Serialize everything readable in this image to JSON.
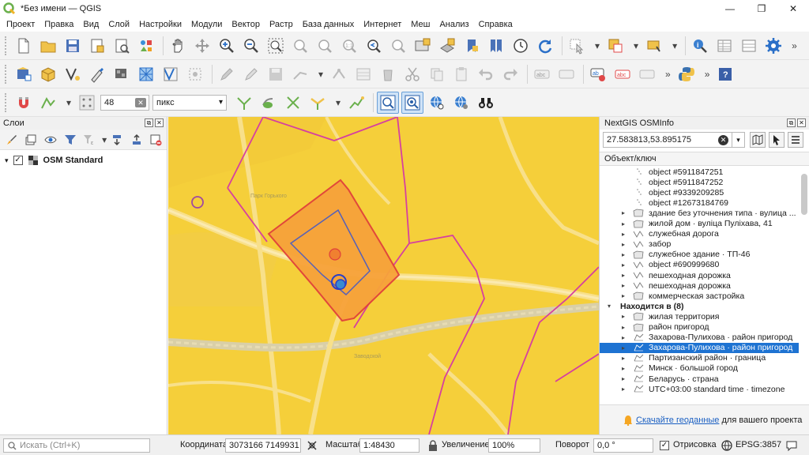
{
  "window": {
    "title": "*Без имени — QGIS"
  },
  "menu": [
    "Проект",
    "Правка",
    "Вид",
    "Слой",
    "Настройки",
    "Модули",
    "Вектор",
    "Растр",
    "База данных",
    "Интернет",
    "Меш",
    "Анализ",
    "Справка"
  ],
  "toolbar3": {
    "snap_tolerance": "48",
    "units": "пикс"
  },
  "layers_panel": {
    "title": "Слои",
    "layers": [
      {
        "name": "OSM Standard",
        "checked": true
      }
    ]
  },
  "osm_panel": {
    "title": "NextGIS OSMInfo",
    "coordinates": "27.583813,53.895175",
    "column_header": "Объект/ключ",
    "rows": [
      {
        "text": "object #5911847251",
        "level": 3,
        "type": "node",
        "expand": false
      },
      {
        "text": "object #5911847252",
        "level": 3,
        "type": "node",
        "expand": false
      },
      {
        "text": "object #9339209285",
        "level": 3,
        "type": "node",
        "expand": false
      },
      {
        "text": "object #12673184769",
        "level": 3,
        "type": "node",
        "expand": false
      },
      {
        "text": "здание без уточнения типа · вулица ...",
        "level": 1,
        "type": "area",
        "expand": true
      },
      {
        "text": "жилой дом · вуліца Пуліхава, 41",
        "level": 1,
        "type": "area",
        "expand": true
      },
      {
        "text": "служебная дорога",
        "level": 1,
        "type": "line",
        "expand": true
      },
      {
        "text": "забор",
        "level": 1,
        "type": "line",
        "expand": true
      },
      {
        "text": "служебное здание · ТП-46",
        "level": 1,
        "type": "area",
        "expand": true
      },
      {
        "text": "object #690999680",
        "level": 1,
        "type": "line",
        "expand": true
      },
      {
        "text": "пешеходная дорожка",
        "level": 1,
        "type": "line",
        "expand": true
      },
      {
        "text": "пешеходная дорожка",
        "level": 1,
        "type": "line",
        "expand": true
      },
      {
        "text": "коммерческая застройка",
        "level": 1,
        "type": "area",
        "expand": true
      },
      {
        "text": "Находится в (8)",
        "level": 0,
        "type": "group",
        "expand": true,
        "open": true
      },
      {
        "text": "жилая территория",
        "level": 1,
        "type": "area",
        "expand": true
      },
      {
        "text": "район пригород",
        "level": 1,
        "type": "area",
        "expand": true
      },
      {
        "text": "Захарова-Пулихова · район пригород",
        "level": 1,
        "type": "relation",
        "expand": true
      },
      {
        "text": "Захарова-Пулихова · район пригород",
        "level": 1,
        "type": "relation",
        "expand": true,
        "selected": true
      },
      {
        "text": "Партизанский район · граница",
        "level": 1,
        "type": "relation",
        "expand": true
      },
      {
        "text": "Минск · большой город",
        "level": 1,
        "type": "relation",
        "expand": true
      },
      {
        "text": "Беларусь · страна",
        "level": 1,
        "type": "relation",
        "expand": true
      },
      {
        "text": "UTC+03:00 standard time · timezone",
        "level": 1,
        "type": "relation",
        "expand": true
      }
    ],
    "notification": {
      "link": "Скачайте геоданные",
      "text": " для вашего проекта"
    }
  },
  "statusbar": {
    "search_placeholder": "Искать (Ctrl+K)",
    "coord_label": "Координата",
    "coord_value": "3073166  7149931",
    "scale_label": "Масштаб",
    "scale_value": "1:48430",
    "zoom_label": "Увеличение",
    "zoom_value": "100%",
    "rotation_label": "Поворот",
    "rotation_value": "0,0 °",
    "render_label": "Отрисовка",
    "crs": "EPSG:3857"
  },
  "colors": {
    "accent": "#1e73d2",
    "map_bg": "#f6d23a",
    "boundary": "#d6409f",
    "highlight_fill": "#f7a23a",
    "highlight_stroke": "#e0403a",
    "building": "#5560b8"
  }
}
